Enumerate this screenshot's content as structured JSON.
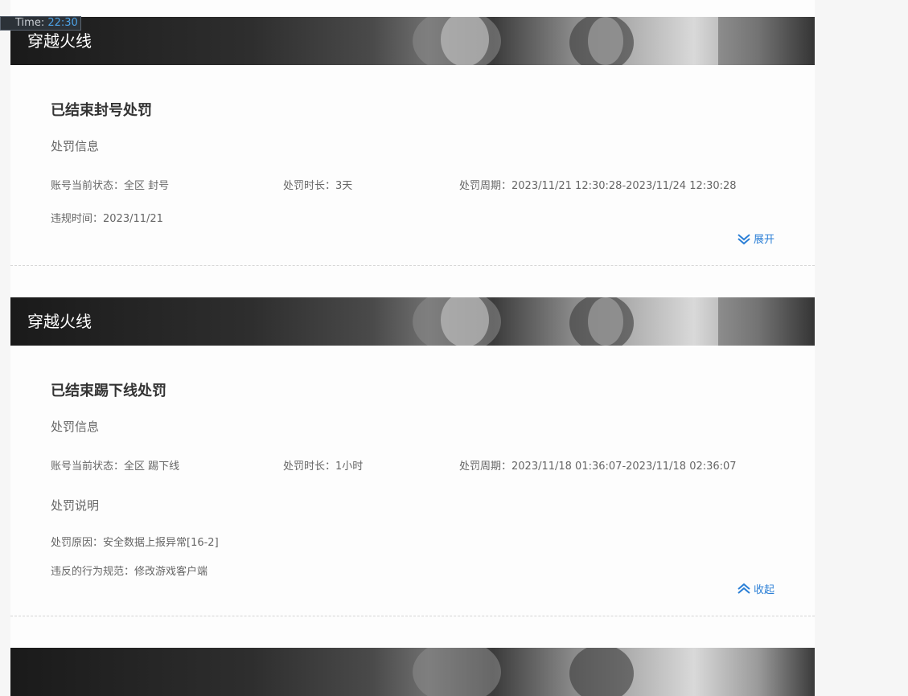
{
  "time": {
    "label": "Time:",
    "value": "22:30"
  },
  "cards": [
    {
      "game": "穿越火线",
      "title": "已结束封号处罚",
      "section_info": "处罚信息",
      "status": "账号当前状态：全区 封号",
      "duration": "处罚时长：3天",
      "period": "处罚周期：2023/11/21 12:30:28-2023/11/24 12:30:28",
      "violation_time": "违规时间：2023/11/21",
      "toggle_label": "展开"
    },
    {
      "game": "穿越火线",
      "title": "已结束踢下线处罚",
      "section_info": "处罚信息",
      "status": "账号当前状态：全区 踢下线",
      "duration": "处罚时长：1小时",
      "period": "处罚周期：2023/11/18 01:36:07-2023/11/18 02:36:07",
      "section_desc": "处罚说明",
      "reason": "处罚原因：安全数据上报异常[16-2]",
      "rule": "违反的行为规范：修改游戏客户端",
      "toggle_label": "收起"
    }
  ]
}
